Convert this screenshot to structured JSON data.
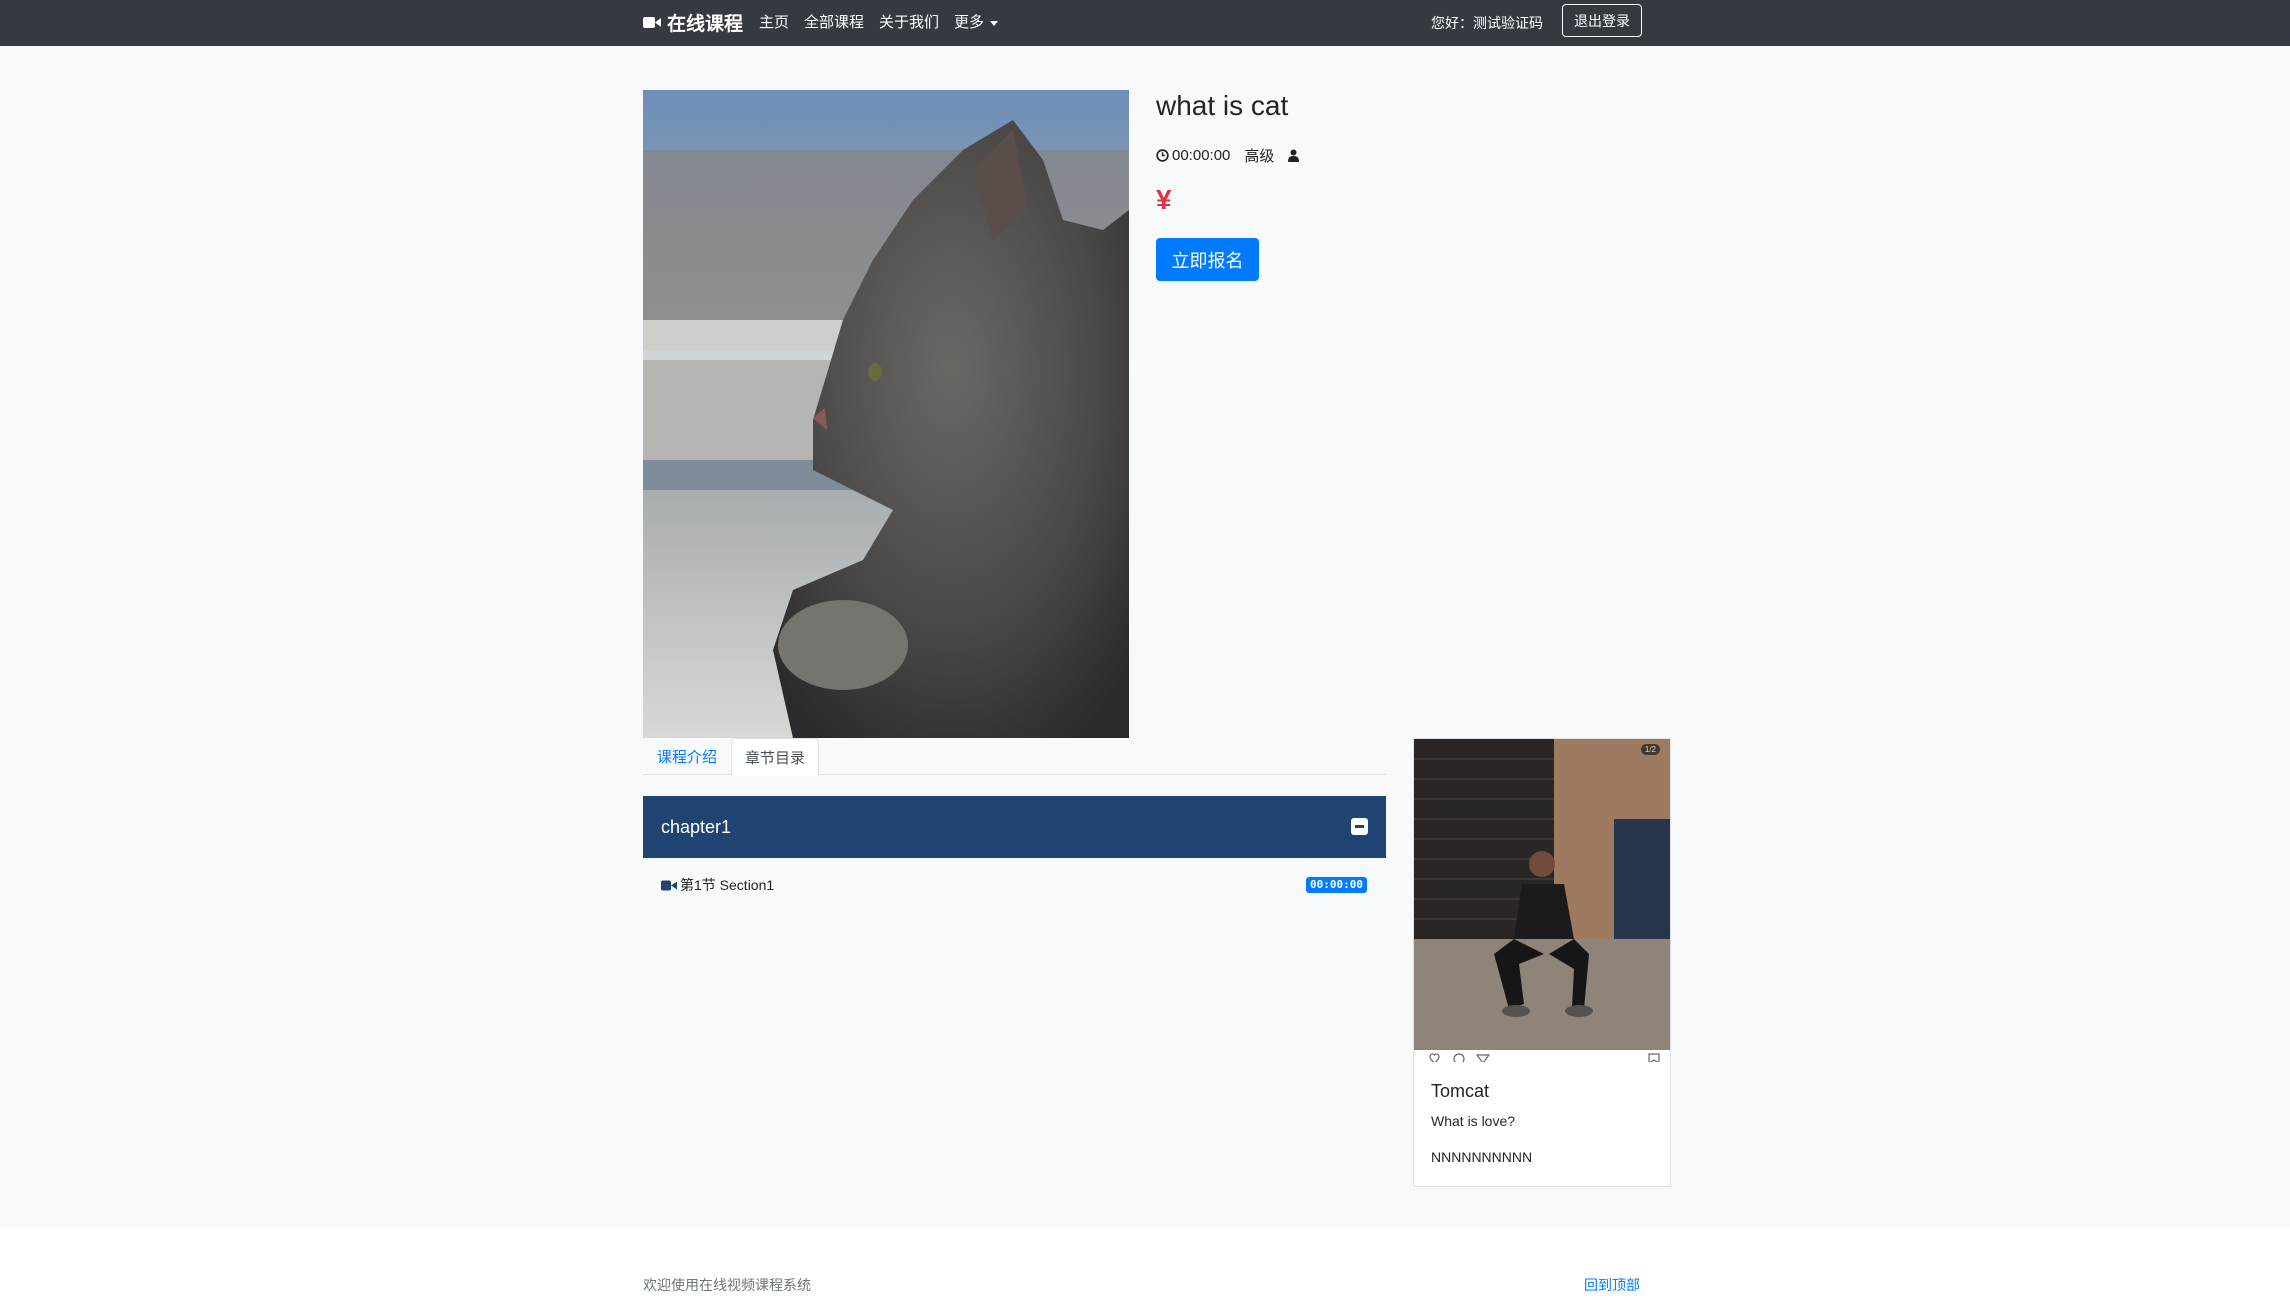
{
  "navbar": {
    "brand": "在线课程",
    "links": [
      "主页",
      "全部课程",
      "关于我们",
      "更多"
    ],
    "greeting": "您好：测试验证码",
    "logout_label": "退出登录"
  },
  "course": {
    "title": "what is cat",
    "duration": "00:00:00",
    "level": "高级",
    "price": "¥",
    "enroll_label": "立即报名"
  },
  "tabs": [
    "课程介绍",
    "章节目录"
  ],
  "chapters": [
    {
      "title": "chapter1",
      "sections": [
        {
          "label": "第1节 Section1",
          "duration": "00:00:00"
        }
      ]
    }
  ],
  "sidebar_card": {
    "counter": "1/2",
    "title": "Tomcat",
    "text1": "What is love?",
    "text2": "NNNNNNNNNN"
  },
  "footer": {
    "text": "欢迎使用在线视频课程系统",
    "back_to_top": "回到顶部"
  },
  "colors": {
    "navbar_bg": "#343a40",
    "accent": "#007bff",
    "chapter_bg": "#1f4471",
    "price": "#dc3545"
  }
}
